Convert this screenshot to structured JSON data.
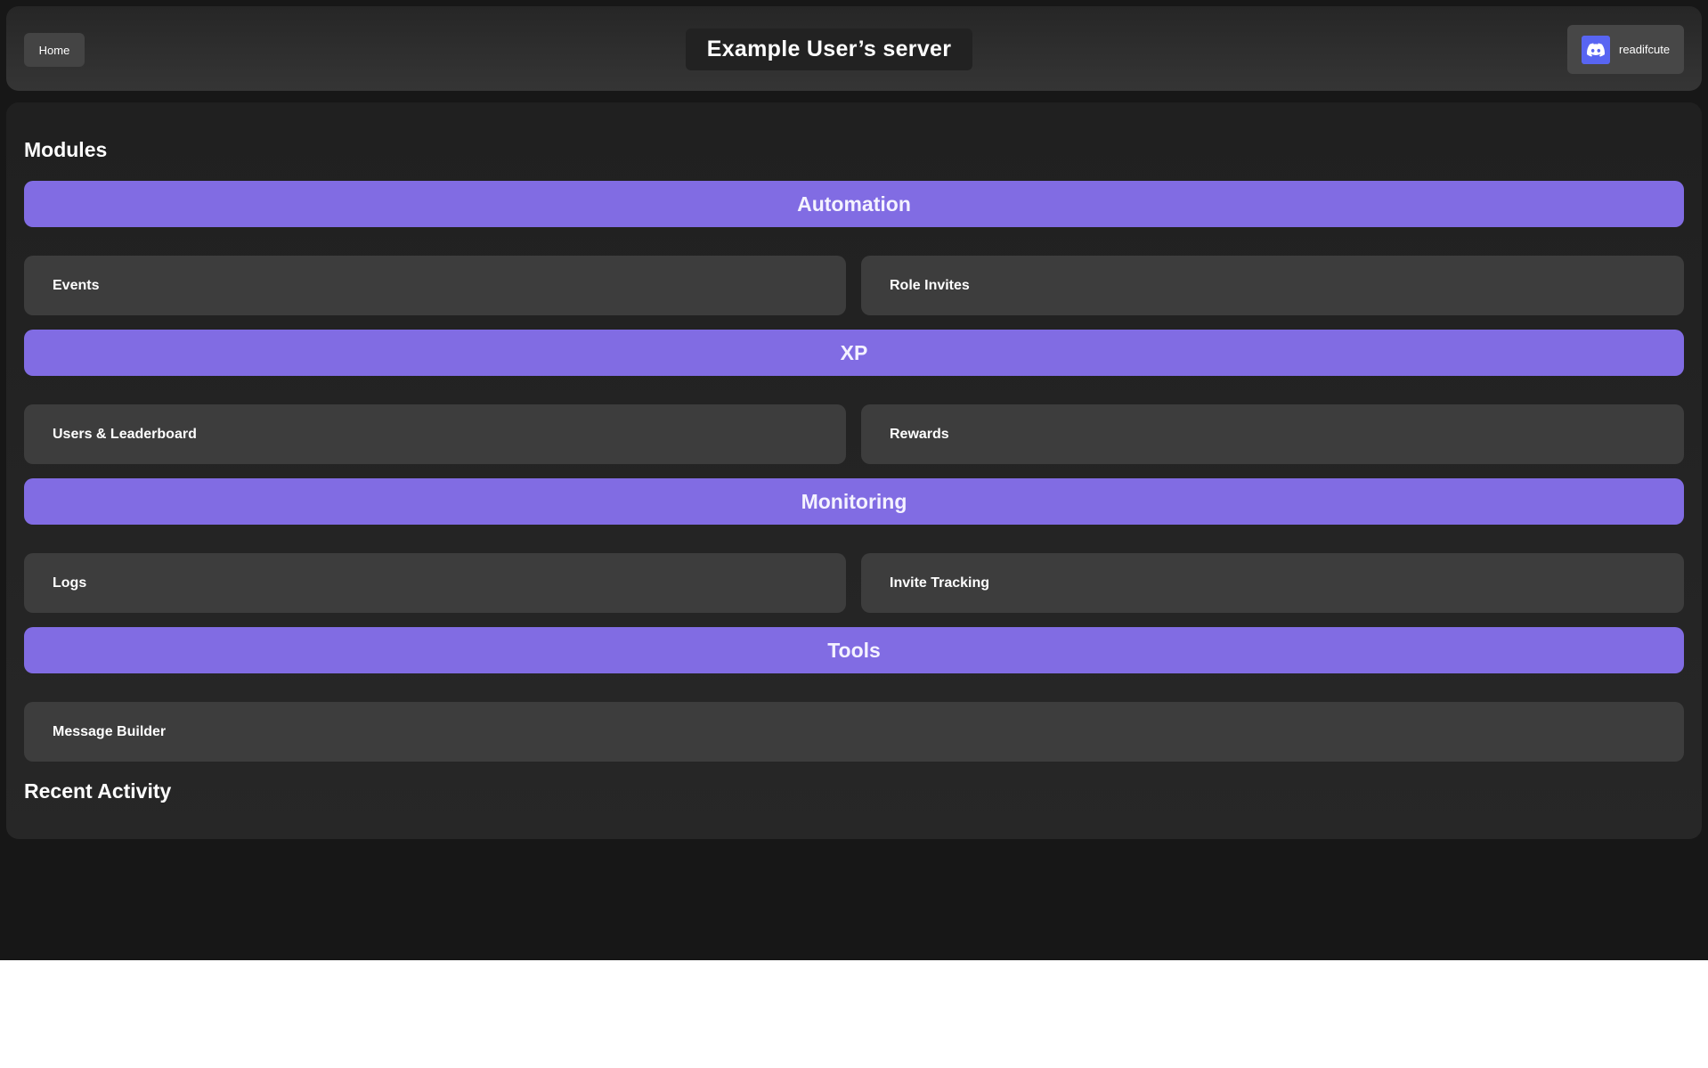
{
  "header": {
    "home_label": "Home",
    "server_title": "Example User’s server",
    "user": {
      "name": "readifcute",
      "icon": "discord-logo-icon",
      "icon_bg": "#5865f2"
    }
  },
  "main": {
    "modules_heading": "Modules",
    "categories": [
      {
        "title": "Automation",
        "modules": [
          "Events",
          "Role Invites"
        ]
      },
      {
        "title": "XP",
        "modules": [
          "Users & Leaderboard",
          "Rewards"
        ]
      },
      {
        "title": "Monitoring",
        "modules": [
          "Logs",
          "Invite Tracking"
        ]
      },
      {
        "title": "Tools",
        "modules": [
          "Message Builder"
        ]
      }
    ],
    "recent_activity_heading": "Recent Activity"
  },
  "colors": {
    "accent": "#816ce3",
    "card": "#3d3d3d",
    "page_bg": "#171717"
  }
}
